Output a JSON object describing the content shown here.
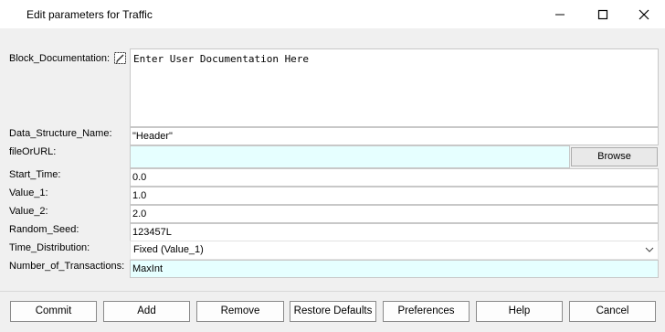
{
  "window": {
    "title": "Edit parameters for Traffic"
  },
  "form": {
    "block_documentation": {
      "label": "Block_Documentation:",
      "value": "Enter User Documentation Here",
      "icon": "edit-documentation-icon"
    },
    "data_structure_name": {
      "label": "Data_Structure_Name:",
      "value": "\"Header\""
    },
    "file_or_url": {
      "label": "fileOrURL:",
      "value": "",
      "button": "Browse"
    },
    "start_time": {
      "label": "Start_Time:",
      "value": "0.0"
    },
    "value_1": {
      "label": "Value_1:",
      "value": "1.0"
    },
    "value_2": {
      "label": "Value_2:",
      "value": "2.0"
    },
    "random_seed": {
      "label": "Random_Seed:",
      "value": "123457L"
    },
    "time_distribution": {
      "label": "Time_Distribution:",
      "selected": "Fixed (Value_1)"
    },
    "number_of_transactions": {
      "label": "Number_of_Transactions:",
      "value": "MaxInt"
    }
  },
  "buttons": {
    "commit": "Commit",
    "add": "Add",
    "remove": "Remove",
    "restore_defaults": "Restore Defaults",
    "preferences": "Preferences",
    "help": "Help",
    "cancel": "Cancel"
  },
  "colors": {
    "dialog_background": "#f0f0f0",
    "highlight_field": "#e6ffff"
  }
}
